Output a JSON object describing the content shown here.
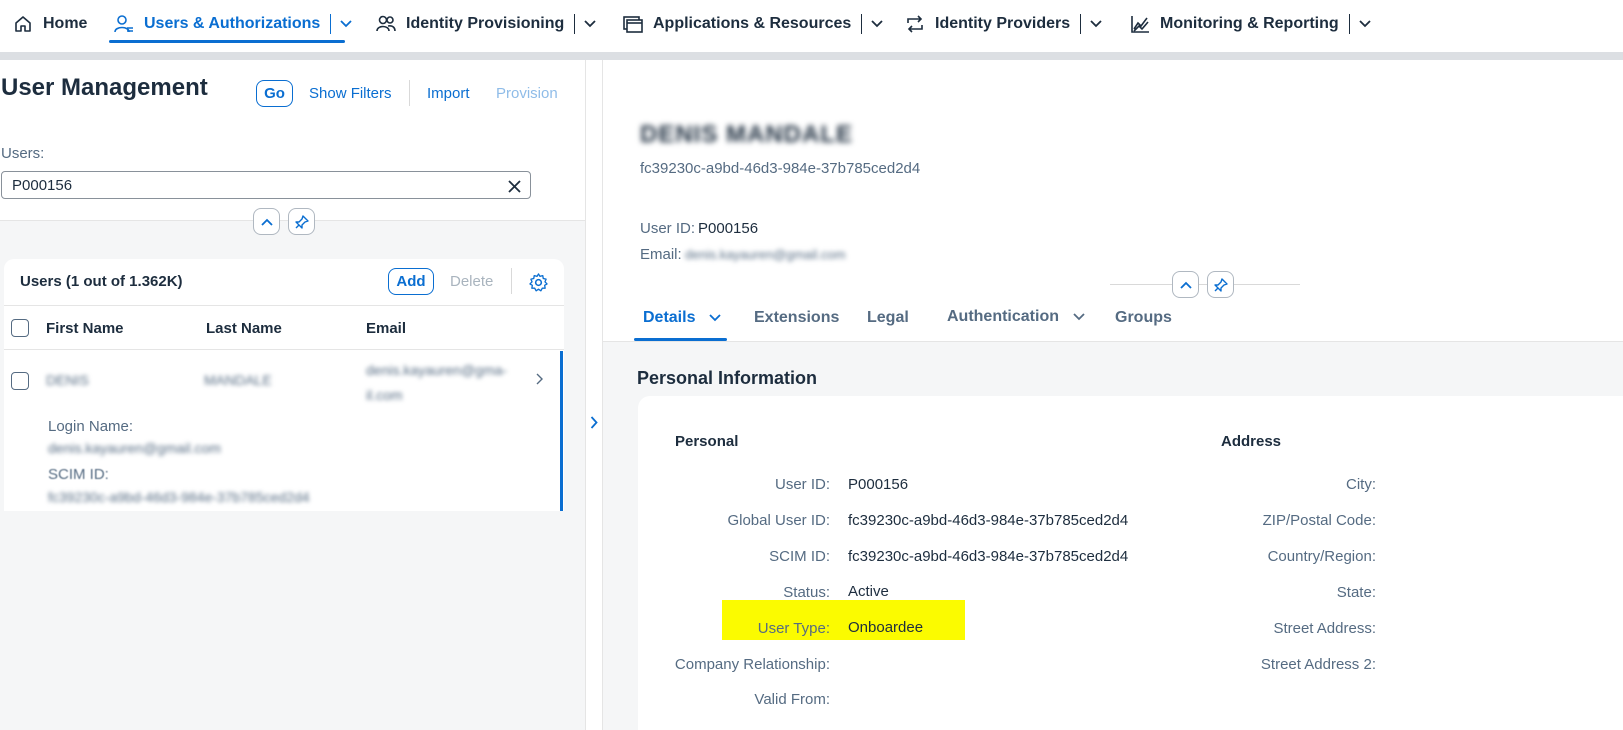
{
  "nav": {
    "items": [
      {
        "label": "Home",
        "icon": "home-icon"
      },
      {
        "label": "Users & Authorizations",
        "icon": "users-icon",
        "active": true
      },
      {
        "label": "Identity Provisioning",
        "icon": "provisioning-icon"
      },
      {
        "label": "Applications & Resources",
        "icon": "applications-icon"
      },
      {
        "label": "Identity Providers",
        "icon": "identity-providers-icon"
      },
      {
        "label": "Monitoring & Reporting",
        "icon": "monitoring-icon"
      }
    ],
    "accent_color": "#0a6ed1"
  },
  "left": {
    "title": "User Management",
    "go_label": "Go",
    "show_filters_label": "Show Filters",
    "import_label": "Import",
    "provision_label": "Provision",
    "users_label": "Users:",
    "search_value": "P000156",
    "table": {
      "title": "Users (1 out of 1.362K)",
      "add_label": "Add",
      "delete_label": "Delete",
      "columns": [
        "First Name",
        "Last Name",
        "Email"
      ],
      "rows": [
        {
          "first_name": "DENIS",
          "last_name": "MANDALE",
          "email_line1": "denis.kayauren@gma-",
          "email_line2": "il.com",
          "login_name_label": "Login Name:",
          "login_name_value": "denis.kayauren@gmail.com",
          "scim_id_label": "SCIM ID:",
          "scim_id_value": "fc39230c-a9bd-46d3-984e-37b785ced2d4"
        }
      ]
    }
  },
  "right": {
    "user_name": "DENIS MANDALE",
    "user_guid": "fc39230c-a9bd-46d3-984e-37b785ced2d4",
    "user_id_label": "User ID:",
    "user_id_value": "P000156",
    "email_label": "Email:",
    "email_value": "denis.kayauren@gmail.com",
    "tabs": [
      {
        "label": "Details",
        "active": true,
        "has_menu": true
      },
      {
        "label": "Extensions"
      },
      {
        "label": "Legal"
      },
      {
        "label": "Authentication",
        "has_menu": true
      },
      {
        "label": "Groups"
      }
    ],
    "section_title": "Personal Information",
    "personal": {
      "title": "Personal",
      "fields": [
        {
          "label": "User ID:",
          "value": "P000156"
        },
        {
          "label": "Global User ID:",
          "value": "fc39230c-a9bd-46d3-984e-37b785ced2d4"
        },
        {
          "label": "SCIM ID:",
          "value": "fc39230c-a9bd-46d3-984e-37b785ced2d4"
        },
        {
          "label": "Status:",
          "value": "Active"
        },
        {
          "label": "User Type:",
          "value": "Onboardee",
          "highlighted": true,
          "highlight_color": "#fbfb00"
        },
        {
          "label": "Company Relationship:",
          "value": ""
        },
        {
          "label": "Valid From:",
          "value": ""
        }
      ]
    },
    "address": {
      "title": "Address",
      "fields": [
        {
          "label": "City:"
        },
        {
          "label": "ZIP/Postal Code:"
        },
        {
          "label": "Country/Region:"
        },
        {
          "label": "State:"
        },
        {
          "label": "Street Address:"
        },
        {
          "label": "Street Address 2:"
        }
      ]
    }
  }
}
